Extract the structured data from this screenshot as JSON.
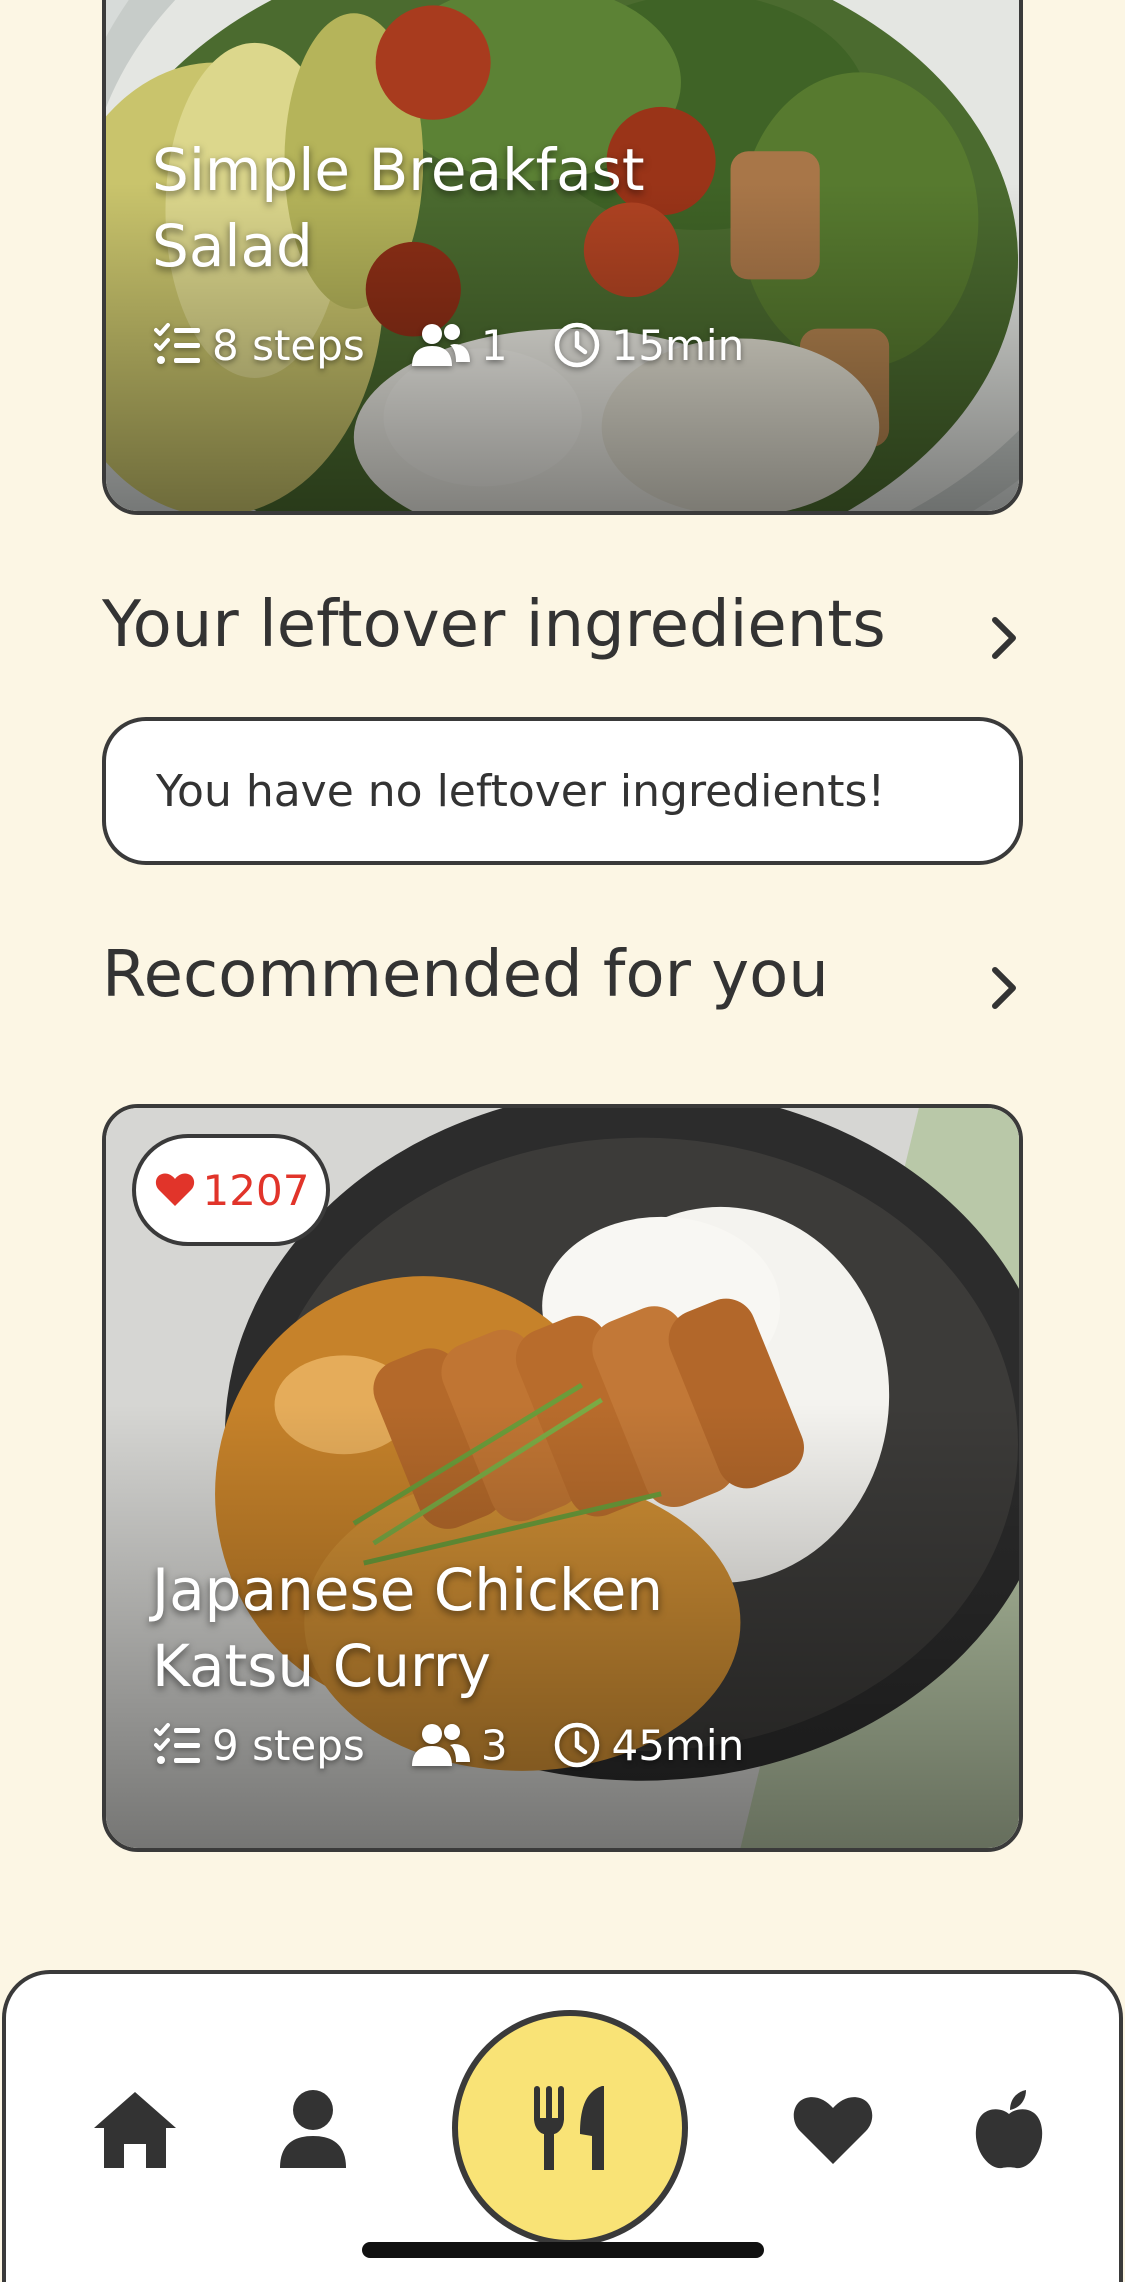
{
  "recipes": [
    {
      "title_line1": "Simple Breakfast",
      "title_line2": "Salad",
      "steps": "8 steps",
      "servings": "1",
      "time": "15min"
    },
    {
      "likes": "1207",
      "title_line1": "Japanese Chicken",
      "title_line2": "Katsu Curry",
      "steps": "9 steps",
      "servings": "3",
      "time": "45min"
    }
  ],
  "sections": {
    "leftover_title": "Your leftover ingredients",
    "leftover_empty": "You have no leftover ingredients!",
    "recommended_title": "Recommended for you"
  },
  "nav": {
    "items": [
      "home-icon",
      "profile-icon",
      "utensils-icon",
      "heart-icon",
      "apple-icon"
    ]
  },
  "colors": {
    "background": "#fcf6e4",
    "accent": "#f9e376",
    "like": "#e1342a",
    "border": "#3a3a3a"
  }
}
